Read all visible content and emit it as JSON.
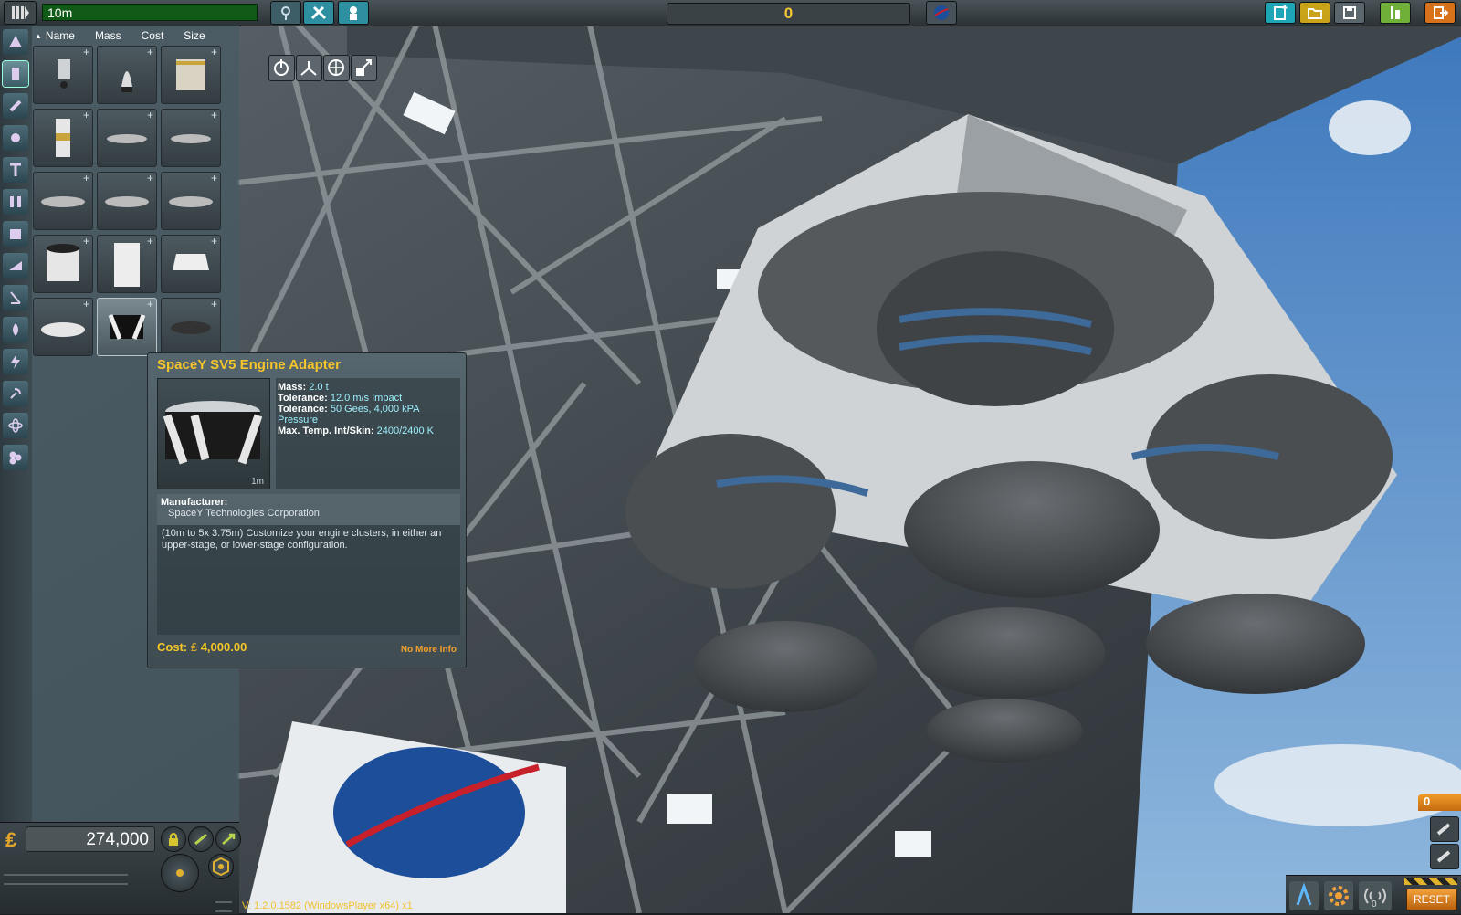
{
  "toolbar": {
    "craft_name": "10m",
    "counter_value": "0",
    "icons": [
      "vab-icon",
      "symmetry-crossfeed-icon",
      "crew-icon"
    ]
  },
  "editor_modes": [
    "engine-power-icon",
    "symmetry-radial-icon",
    "snap-angle-icon",
    "offset-icon"
  ],
  "parts_panel": {
    "sort_headers": [
      "Name",
      "Mass",
      "Cost",
      "Size"
    ],
    "selected_index": 13,
    "plus_glyph": "+"
  },
  "tooltip": {
    "title": "SpaceY SV5 Engine Adapter",
    "size": "1m",
    "stats": {
      "mass_label": "Mass:",
      "mass_value": "2.0 t",
      "tol1_label": "Tolerance:",
      "tol1_value": "12.0 m/s Impact",
      "tol2_label": "Tolerance:",
      "tol2_value": "50 Gees, 4,000 kPA Pressure",
      "temp_label": "Max. Temp. Int/Skin:",
      "temp_value": "2400/2400 K"
    },
    "manufacturer_label": "Manufacturer:",
    "manufacturer": "SpaceY Technologies Corporation",
    "description": "(10m to 5x 3.75m) Customize your engine clusters, in either an upper-stage, or lower-stage configuration.",
    "cost_label": "Cost:",
    "cost_value": "4,000.00",
    "more_info": "No More Info"
  },
  "funds": "274,000",
  "version": "V: 1.2.0.1582 (WindowsPlayer x64) x1",
  "staging": {
    "stage_number": "0",
    "reset_label": "RESET",
    "bottom_counter": "0"
  },
  "colors": {
    "accent_yellow": "#f5c52a",
    "accent_orange": "#f09a28",
    "craft_name_bg": "#0f5a16",
    "sky": "#4f86c0"
  }
}
